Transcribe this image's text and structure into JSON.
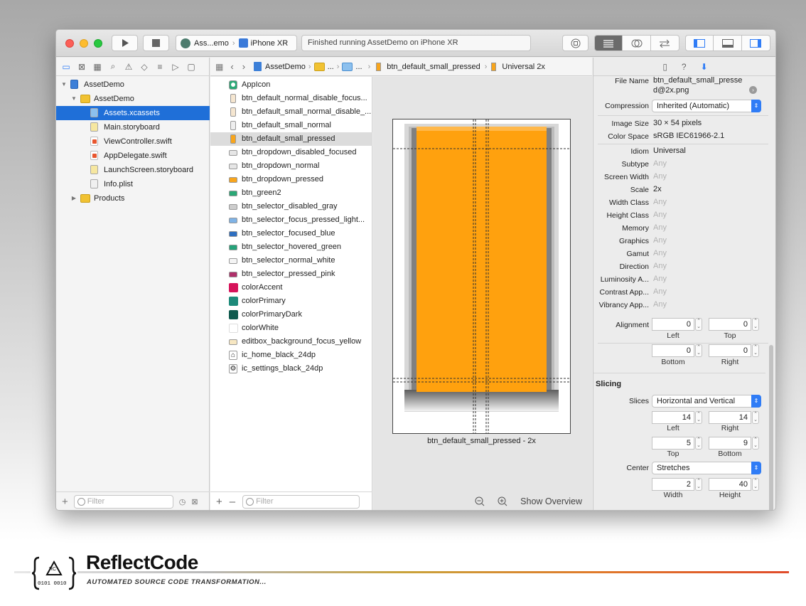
{
  "toolbar": {
    "scheme_target": "Ass...emo",
    "scheme_device": "iPhone XR",
    "status": "Finished running AssetDemo on iPhone XR"
  },
  "navigator": {
    "tree": [
      {
        "label": "AssetDemo",
        "indent": 0,
        "kind": "project",
        "disclosure": "open"
      },
      {
        "label": "AssetDemo",
        "indent": 1,
        "kind": "folder",
        "disclosure": "open"
      },
      {
        "label": "Assets.xcassets",
        "indent": 2,
        "kind": "xcassets",
        "selected": true
      },
      {
        "label": "Main.storyboard",
        "indent": 2,
        "kind": "storyboard"
      },
      {
        "label": "ViewController.swift",
        "indent": 2,
        "kind": "swift"
      },
      {
        "label": "AppDelegate.swift",
        "indent": 2,
        "kind": "swift"
      },
      {
        "label": "LaunchScreen.storyboard",
        "indent": 2,
        "kind": "storyboard"
      },
      {
        "label": "Info.plist",
        "indent": 2,
        "kind": "plist"
      },
      {
        "label": "Products",
        "indent": 1,
        "kind": "folder",
        "disclosure": "closed"
      }
    ],
    "filter_placeholder": "Filter"
  },
  "jumpbar": {
    "items": [
      "AssetDemo",
      "...",
      "...",
      "btn_default_small_pressed",
      "Universal 2x"
    ]
  },
  "assets": {
    "items": [
      {
        "label": "AppIcon",
        "swatch": "appicon"
      },
      {
        "label": "btn_default_normal_disable_focus...",
        "swatch": "#f5e6d0"
      },
      {
        "label": "btn_default_small_normal_disable_...",
        "swatch": "#f5e6d0"
      },
      {
        "label": "btn_default_small_normal",
        "swatch": "#eeeeee"
      },
      {
        "label": "btn_default_small_pressed",
        "swatch": "#f8a51c",
        "selected": true
      },
      {
        "label": "btn_dropdown_disabled_focused",
        "swatch": "#e6e6e6"
      },
      {
        "label": "btn_dropdown_normal",
        "swatch": "#e6e6e6"
      },
      {
        "label": "btn_dropdown_pressed",
        "swatch": "#f8a51c"
      },
      {
        "label": "btn_green2",
        "swatch": "#2aa876"
      },
      {
        "label": "btn_selector_disabled_gray",
        "swatch": "#cccccc"
      },
      {
        "label": "btn_selector_focus_pressed_light...",
        "swatch": "#7fb3e6"
      },
      {
        "label": "btn_selector_focused_blue",
        "swatch": "#2f6fc0"
      },
      {
        "label": "btn_selector_hovered_green",
        "swatch": "#25a37a"
      },
      {
        "label": "btn_selector_normal_white",
        "swatch": "#f4f4f4"
      },
      {
        "label": "btn_selector_pressed_pink",
        "swatch": "#b0306a"
      },
      {
        "label": "colorAccent",
        "swatch": "#d6135a"
      },
      {
        "label": "colorPrimary",
        "swatch": "#1d8a7a"
      },
      {
        "label": "colorPrimaryDark",
        "swatch": "#0f5a4e"
      },
      {
        "label": "colorWhite",
        "swatch": "#ffffff"
      },
      {
        "label": "editbox_background_focus_yellow",
        "swatch": "#f7e7c2"
      },
      {
        "label": "ic_home_black_24dp",
        "swatch": "home"
      },
      {
        "label": "ic_settings_black_24dp",
        "swatch": "settings"
      }
    ],
    "filter_placeholder": "Filter"
  },
  "canvas": {
    "caption": "btn_default_small_pressed - 2x",
    "show_overview": "Show Overview",
    "fill_color": "#ffa10e"
  },
  "inspector": {
    "file_name_label": "File Name",
    "file_name_line1": "btn_default_small_presse",
    "file_name_line2": "d@2x.png",
    "compression_label": "Compression",
    "compression_value": "Inherited (Automatic)",
    "image_size_label": "Image Size",
    "image_size_value": "30 × 54 pixels",
    "color_space_label": "Color Space",
    "color_space_value": "sRGB IEC61966-2.1",
    "traits": [
      {
        "label": "Idiom",
        "value": "Universal",
        "any": false
      },
      {
        "label": "Subtype",
        "value": "Any",
        "any": true
      },
      {
        "label": "Screen Width",
        "value": "Any",
        "any": true
      },
      {
        "label": "Scale",
        "value": "2x",
        "any": false
      },
      {
        "label": "Width Class",
        "value": "Any",
        "any": true
      },
      {
        "label": "Height Class",
        "value": "Any",
        "any": true
      },
      {
        "label": "Memory",
        "value": "Any",
        "any": true
      },
      {
        "label": "Graphics",
        "value": "Any",
        "any": true
      },
      {
        "label": "Gamut",
        "value": "Any",
        "any": true
      },
      {
        "label": "Direction",
        "value": "Any",
        "any": true
      },
      {
        "label": "Luminosity A...",
        "value": "Any",
        "any": true
      },
      {
        "label": "Contrast App...",
        "value": "Any",
        "any": true
      },
      {
        "label": "Vibrancy App...",
        "value": "Any",
        "any": true
      }
    ],
    "alignment": {
      "label": "Alignment",
      "left": "0",
      "top": "0",
      "bottom": "0",
      "right": "0",
      "left_cap": "Left",
      "top_cap": "Top",
      "bottom_cap": "Bottom",
      "right_cap": "Right"
    },
    "slicing": {
      "title": "Slicing",
      "slices_label": "Slices",
      "slices_value": "Horizontal and Vertical",
      "left": "14",
      "right": "14",
      "top": "5",
      "bottom": "9",
      "left_cap": "Left",
      "right_cap": "Right",
      "top_cap": "Top",
      "bottom_cap": "Bottom",
      "center_label": "Center",
      "center_value": "Stretches",
      "width": "2",
      "height": "40",
      "width_cap": "Width",
      "height_cap": "Height"
    }
  },
  "branding": {
    "name": "ReflectCode",
    "tagline": "AUTOMATED SOURCE CODE TRANSFORMATION...",
    "badge_top": "RC",
    "badge_bottom": "0101 0010"
  }
}
